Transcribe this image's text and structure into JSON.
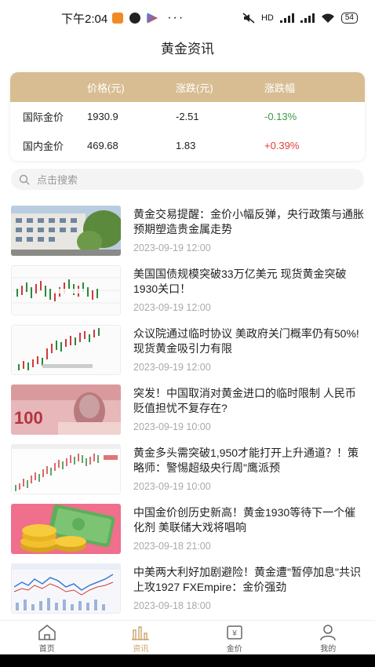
{
  "status_bar": {
    "time": "下午2:04",
    "battery": "54",
    "signal_label": "HD"
  },
  "page_title": "黄金资讯",
  "price_table": {
    "headers": [
      "",
      "价格(元)",
      "涨跌(元)",
      "涨跌幅"
    ],
    "rows": [
      {
        "name": "国际金价",
        "price": "1930.9",
        "change": "-2.51",
        "percent": "-0.13%"
      },
      {
        "name": "国内金价",
        "price": "469.68",
        "change": "1.83",
        "percent": "+0.39%"
      }
    ],
    "colors": {
      "header_bg": "#d8bd93",
      "down": "#3a9a44",
      "up": "#e0403a"
    }
  },
  "search": {
    "placeholder": "点击搜索",
    "icon": "search-icon"
  },
  "news": [
    {
      "title": "黄金交易提醒：金价小幅反弹，央行政策与通胀预期塑造贵金属走势",
      "date": "2023-09-19 12:00",
      "thumb": "building-photo"
    },
    {
      "title": "美国国债规模突破33万亿美元 现货黄金突破1930关口！",
      "date": "2023-09-19 12:00",
      "thumb": "candlestick-chart"
    },
    {
      "title": "众议院通过临时协议 美政府关门概率仍有50%!现货黄金吸引力有限",
      "date": "2023-09-19 12:00",
      "thumb": "candlestick-chart"
    },
    {
      "title": "突发！中国取消对黄金进口的临时限制 人民币贬值担忧不复存在?",
      "date": "2023-09-19 10:00",
      "thumb": "banknote-photo"
    },
    {
      "title": "黄金多头需突破1,950才能打开上升通道？！策略师：警惕超级央行周\"鹰派预",
      "date": "2023-09-19 10:00",
      "thumb": "candlestick-chart"
    },
    {
      "title": "中国金价创历史新高！黄金1930等待下一个催化剂 美联储大戏将唱响",
      "date": "2023-09-18 21:00",
      "thumb": "coins-illustration"
    },
    {
      "title": "中美两大利好加剧避险！黄金遭\"暂停加息\"共识上攻1927 FXEmpire：金价强劲",
      "date": "2023-09-18 18:00",
      "thumb": "line-chart"
    }
  ],
  "tabs": [
    {
      "label": "首页",
      "icon": "home-icon",
      "active": false
    },
    {
      "label": "资讯",
      "icon": "news-chart-icon",
      "active": true
    },
    {
      "label": "金价",
      "icon": "price-tag-icon",
      "active": false
    },
    {
      "label": "我的",
      "icon": "user-icon",
      "active": false
    }
  ],
  "accent_color": "#c9a46b"
}
